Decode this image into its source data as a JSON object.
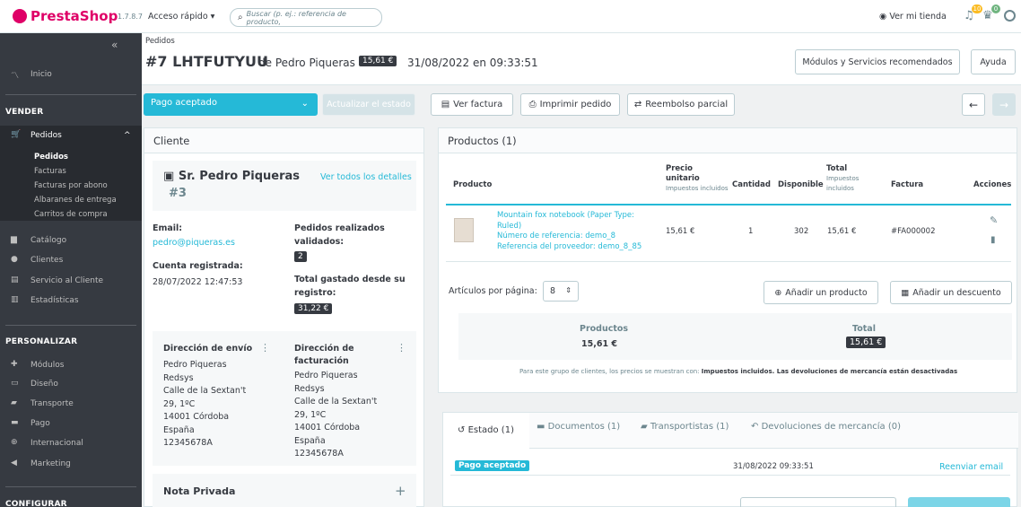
{
  "topbar": {
    "logo": "PrestaShop",
    "version": "1.7.8.7",
    "quick_access": "Acceso rápido",
    "search_placeholder": "Buscar (p. ej.: referencia de producto,",
    "view_store": "Ver mi tienda",
    "badge_orders": "10",
    "badge_customers": "0"
  },
  "sidebar": {
    "home": "Inicio",
    "sec_sell": "VENDER",
    "orders": "Pedidos",
    "sub": [
      "Pedidos",
      "Facturas",
      "Facturas por abono",
      "Albaranes de entrega",
      "Carritos de compra"
    ],
    "sell_items": [
      "Catálogo",
      "Clientes",
      "Servicio al Cliente",
      "Estadísticas"
    ],
    "sec_customize": "PERSONALIZAR",
    "customize_items": [
      "Módulos",
      "Diseño",
      "Transporte",
      "Pago",
      "Internacional",
      "Marketing"
    ],
    "sec_configure": "CONFIGURAR"
  },
  "header": {
    "breadcrumb": "Pedidos",
    "order_ref": "#7 LHTFUTYUU",
    "of": "de Pedro Piqueras",
    "total_badge": "15,61 €",
    "date": "31/08/2022 en 09:33:51",
    "btn_modules": "Módulos y Servicios recomendados",
    "btn_help": "Ayuda"
  },
  "toolbar": {
    "status_select": "Pago aceptado",
    "update_status": "Actualizar el estado",
    "view_invoice": "Ver factura",
    "print_order": "Imprimir pedido",
    "partial_refund": "Reembolso parcial"
  },
  "customer": {
    "head": "Cliente",
    "name": "Sr. Pedro Piqueras",
    "id": "#3",
    "view_all": "Ver todos los detalles",
    "email_label": "Email:",
    "email": "pedro@piqueras.es",
    "registered_label": "Cuenta registrada:",
    "registered": "28/07/2022 12:47:53",
    "orders_label_1": "Pedidos realizados",
    "orders_label_2": "validados:",
    "orders_count": "2",
    "spent_label_1": "Total gastado desde su",
    "spent_label_2": "registro:",
    "spent": "31,22 €",
    "ship_head": "Dirección de envío",
    "bill_head_1": "Dirección de",
    "bill_head_2": "facturación",
    "ship_lines": [
      "Pedro Piqueras",
      "Redsys",
      "Calle de la Sextan't",
      "29, 1ºC",
      "14001 Córdoba",
      "España",
      "12345678A"
    ],
    "bill_lines": [
      "Pedro Piqueras",
      "Redsys",
      "Calle de la Sextan't",
      "29, 1ºC",
      "14001 Córdoba",
      "España",
      "12345678A"
    ],
    "private_note": "Nota Privada"
  },
  "products": {
    "head": "Productos (1)",
    "col_product": "Producto",
    "col_unit_1": "Precio",
    "col_unit_2": "unitario",
    "col_unit_3": "Impuestos incluidos",
    "col_qty": "Cantidad",
    "col_avail": "Disponible",
    "col_total_1": "Total",
    "col_total_2": "Impuestos",
    "col_total_3": "incluidos",
    "col_invoice": "Factura",
    "col_actions": "Acciones",
    "row": {
      "name_1": "Mountain fox notebook (Paper Type:",
      "name_2": "Ruled)",
      "ref": "Número de referencia: demo_8",
      "supplier_ref": "Referencia del proveedor: demo_8_85",
      "unit": "15,61 €",
      "qty": "1",
      "avail": "302",
      "total": "15,61 €",
      "invoice": "#FA000002"
    },
    "per_page_label": "Artículos por página:",
    "per_page": "8",
    "add_product": "Añadir un producto",
    "add_discount": "Añadir un descuento",
    "sum_products_label": "Productos",
    "sum_products": "15,61 €",
    "sum_total_label": "Total",
    "sum_total": "15,61 €",
    "note_prefix": "Para este grupo de clientes, los precios se muestran con: ",
    "note_bold": "Impuestos incluidos. Las devoluciones de mercancía están desactivadas"
  },
  "tabs": {
    "status": "Estado (1)",
    "documents": "Documentos (1)",
    "carriers": "Transportistas (1)",
    "returns": "Devoluciones de mercancía (0)",
    "row_status": "Pago aceptado",
    "row_date": "31/08/2022 09:33:51",
    "resend": "Reenviar email"
  }
}
